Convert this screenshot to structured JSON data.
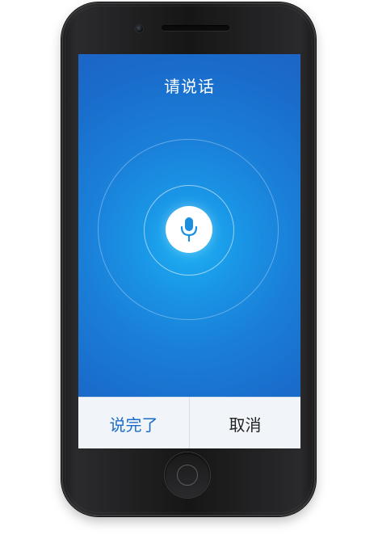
{
  "screen": {
    "title": "请说话"
  },
  "buttons": {
    "done_label": "说完了",
    "cancel_label": "取消"
  },
  "icons": {
    "mic": "microphone-icon"
  },
  "colors": {
    "screen_blue": "#1a7fd8",
    "accent_blue": "#1a6cc9",
    "button_bar": "#f1f5f9"
  }
}
